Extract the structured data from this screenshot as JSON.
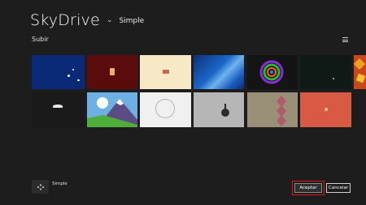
{
  "header": {
    "app_title": "SkyDrive",
    "chevron": "⌄",
    "view_label": "Simple"
  },
  "toolbar": {
    "upload_label": "Subir",
    "view_toggle_icon": "list-view-icon"
  },
  "thumbnails": [
    {
      "name": "blue-birds",
      "color": "#0a2a78"
    },
    {
      "name": "red-jar",
      "color": "#5a0c0c"
    },
    {
      "name": "cream-box",
      "color": "#f7e8c6"
    },
    {
      "name": "blue-waves",
      "color": "#1b67c8"
    },
    {
      "name": "neon-swirl",
      "color": "#141414"
    },
    {
      "name": "dark-sparkle",
      "color": "#0f1a17"
    },
    {
      "name": "autumn-leaves",
      "color": "#c8481a"
    },
    {
      "name": "dark-bird",
      "color": "#1a1a1a"
    },
    {
      "name": "mountain-landscape",
      "color": "#6db0e4"
    },
    {
      "name": "white-sketch",
      "color": "#f0f0f0"
    },
    {
      "name": "grey-figure",
      "color": "#b6b6b6"
    },
    {
      "name": "diamond-pattern",
      "color": "#9a8f77"
    },
    {
      "name": "coral-flower",
      "color": "#d85a44"
    }
  ],
  "footer": {
    "user_name": "Simple",
    "accept_label": "Aceptar",
    "cancel_label": "Cancelar",
    "highlight_color": "#e21818"
  }
}
